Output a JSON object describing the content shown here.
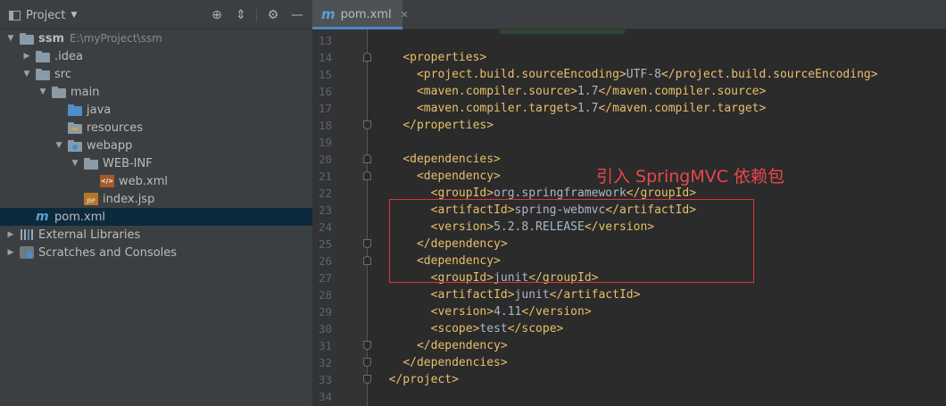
{
  "project_panel": {
    "title": "Project",
    "tree": [
      {
        "label": "ssm",
        "path": "E:\\myProject\\ssm",
        "icon": "module-folder-icon",
        "depth": 0,
        "expanded": true
      },
      {
        "label": ".idea",
        "icon": "folder-icon",
        "depth": 1,
        "expanded": false
      },
      {
        "label": "src",
        "icon": "folder-icon",
        "depth": 1,
        "expanded": true
      },
      {
        "label": "main",
        "icon": "folder-icon",
        "depth": 2,
        "expanded": true
      },
      {
        "label": "java",
        "icon": "source-folder-icon",
        "depth": 3
      },
      {
        "label": "resources",
        "icon": "resources-folder-icon",
        "depth": 3
      },
      {
        "label": "webapp",
        "icon": "web-folder-icon",
        "depth": 3,
        "expanded": true
      },
      {
        "label": "WEB-INF",
        "icon": "folder-icon",
        "depth": 4,
        "expanded": true
      },
      {
        "label": "web.xml",
        "icon": "xml-file-icon",
        "depth": 5
      },
      {
        "label": "index.jsp",
        "icon": "jsp-file-icon",
        "depth": 4
      },
      {
        "label": "pom.xml",
        "icon": "maven-icon",
        "depth": 1,
        "selected": true
      },
      {
        "label": "External Libraries",
        "icon": "libraries-icon",
        "depth": 0,
        "expanded": false
      },
      {
        "label": "Scratches and Consoles",
        "icon": "scratches-icon",
        "depth": 0,
        "expanded": false
      }
    ]
  },
  "editor": {
    "tab": {
      "label": "pom.xml",
      "icon": "maven-icon"
    },
    "lines": [
      {
        "num": "13",
        "text": ""
      },
      {
        "num": "14",
        "text": "    <properties>"
      },
      {
        "num": "15",
        "text": "      <project.build.sourceEncoding>UTF-8</project.build.sourceEncoding>"
      },
      {
        "num": "16",
        "text": "      <maven.compiler.source>1.7</maven.compiler.source>"
      },
      {
        "num": "17",
        "text": "      <maven.compiler.target>1.7</maven.compiler.target>"
      },
      {
        "num": "18",
        "text": "    </properties>"
      },
      {
        "num": "19",
        "text": ""
      },
      {
        "num": "20",
        "text": "    <dependencies>"
      },
      {
        "num": "21",
        "text": "      <dependency>"
      },
      {
        "num": "22",
        "text": "        <groupId>org.springframework</groupId>"
      },
      {
        "num": "23",
        "text": "        <artifactId>spring-webmvc</artifactId>"
      },
      {
        "num": "24",
        "text": "        <version>5.2.8.RELEASE</version>"
      },
      {
        "num": "25",
        "text": "      </dependency>"
      },
      {
        "num": "26",
        "text": "      <dependency>"
      },
      {
        "num": "27",
        "text": "        <groupId>junit</groupId>"
      },
      {
        "num": "28",
        "text": "        <artifactId>junit</artifactId>"
      },
      {
        "num": "29",
        "text": "        <version>4.11</version>"
      },
      {
        "num": "30",
        "text": "        <scope>test</scope>"
      },
      {
        "num": "31",
        "text": "      </dependency>"
      },
      {
        "num": "32",
        "text": "    </dependencies>"
      },
      {
        "num": "33",
        "text": "  </project>"
      },
      {
        "num": "34",
        "text": ""
      }
    ],
    "annotation": "引入 SpringMVC 依赖包"
  },
  "colors": {
    "tag": "#e8bf6a",
    "text": "#a9b7c6",
    "annotation": "#e8484b",
    "selection": "#0d293e"
  }
}
